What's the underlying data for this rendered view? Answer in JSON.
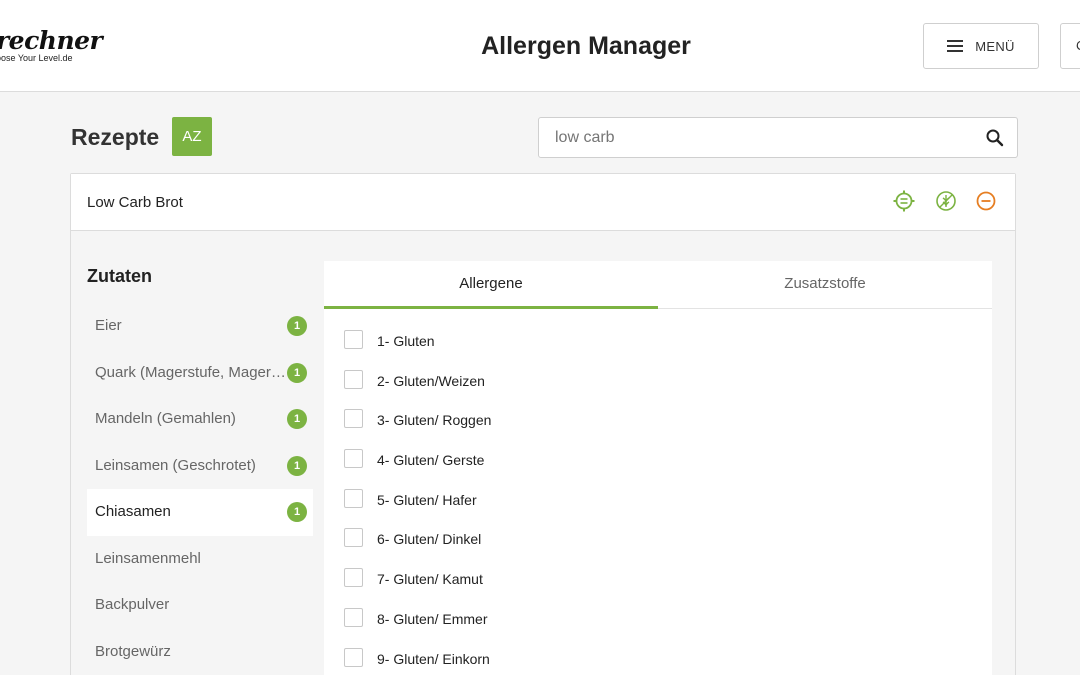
{
  "header": {
    "logo_text": "rechner",
    "logo_tagline": "oose Your Level.de",
    "title": "Allergen Manager",
    "menu_label": "MENÜ",
    "extra_button_label": "C"
  },
  "recipes": {
    "title": "Rezepte",
    "sort_label": "AZ",
    "search": {
      "value": "",
      "placeholder": "low carb"
    }
  },
  "recipe": {
    "name": "Low Carb Brot",
    "icons": [
      "settings-icon",
      "no-gluten-icon",
      "remove-icon"
    ]
  },
  "ingredients": {
    "title": "Zutaten",
    "items": [
      {
        "name": "Eier",
        "count": "1"
      },
      {
        "name": "Quark (Magerstufe, Magerquark)",
        "count": "1"
      },
      {
        "name": "Mandeln (Gemahlen)",
        "count": "1"
      },
      {
        "name": "Leinsamen (Geschrotet)",
        "count": "1"
      },
      {
        "name": "Chiasamen",
        "count": "1"
      },
      {
        "name": "Leinsamenmehl"
      },
      {
        "name": "Backpulver"
      },
      {
        "name": "Brotgewürz"
      }
    ]
  },
  "tabs": [
    {
      "label": "Allergene"
    },
    {
      "label": "Zusatzstoffe"
    }
  ],
  "allergens": [
    {
      "label": "1- Gluten"
    },
    {
      "label": "2- Gluten/Weizen"
    },
    {
      "label": "3- Gluten/ Roggen"
    },
    {
      "label": "4- Gluten/ Gerste"
    },
    {
      "label": "5- Gluten/ Hafer"
    },
    {
      "label": "6- Gluten/ Dinkel"
    },
    {
      "label": "7- Gluten/ Kamut"
    },
    {
      "label": "8- Gluten/ Emmer"
    },
    {
      "label": "9- Gluten/ Einkorn"
    }
  ],
  "colors": {
    "accent_green": "#7cb342",
    "remove_orange": "#e67e22"
  }
}
